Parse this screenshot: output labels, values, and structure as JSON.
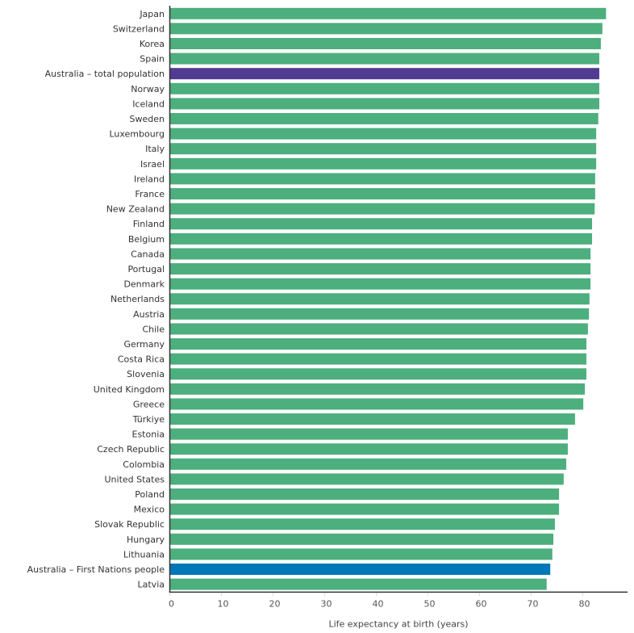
{
  "chart_data": {
    "type": "bar",
    "orientation": "horizontal",
    "title": "",
    "xlabel": "Life expectancy at birth (years)",
    "ylabel": "",
    "xlim": [
      0,
      88
    ],
    "x_ticks": [
      0,
      10,
      20,
      30,
      40,
      50,
      60,
      70,
      80
    ],
    "x_tick_labels": [
      "0",
      "10",
      "20",
      "30",
      "40",
      "50",
      "60",
      "70",
      "80"
    ],
    "grid": false,
    "legend": null,
    "colors": {
      "default": "#4caf7d",
      "australia_total": "#4f3b91",
      "australia_first_nations": "#0077b6",
      "axis": "#333333",
      "text": "#333333"
    },
    "categories": [
      "Japan",
      "Switzerland",
      "Korea",
      "Spain",
      "Australia – total population",
      "Norway",
      "Iceland",
      "Sweden",
      "Luxembourg",
      "Italy",
      "Israel",
      "Ireland",
      "France",
      "New Zealand",
      "Finland",
      "Belgium",
      "Canada",
      "Portugal",
      "Denmark",
      "Netherlands",
      "Austria",
      "Chile",
      "Germany",
      "Costa Rica",
      "Slovenia",
      "United Kingdom",
      "Greece",
      "Türkiye",
      "Estonia",
      "Czech Republic",
      "Colombia",
      "United States",
      "Poland",
      "Mexico",
      "Slovak Republic",
      "Hungary",
      "Lithuania",
      "Australia – First Nations people",
      "Latvia"
    ],
    "values": [
      84.5,
      83.8,
      83.5,
      83.2,
      83.2,
      83.2,
      83.2,
      83.0,
      82.6,
      82.6,
      82.6,
      82.4,
      82.4,
      82.3,
      81.8,
      81.8,
      81.5,
      81.5,
      81.5,
      81.3,
      81.2,
      81.0,
      80.7,
      80.7,
      80.7,
      80.4,
      80.1,
      78.5,
      77.1,
      77.1,
      76.8,
      76.3,
      75.4,
      75.4,
      74.6,
      74.3,
      74.1,
      73.7,
      73.0
    ],
    "highlight": {
      "Australia – total population": "australia_total",
      "Australia – First Nations people": "australia_first_nations"
    }
  }
}
